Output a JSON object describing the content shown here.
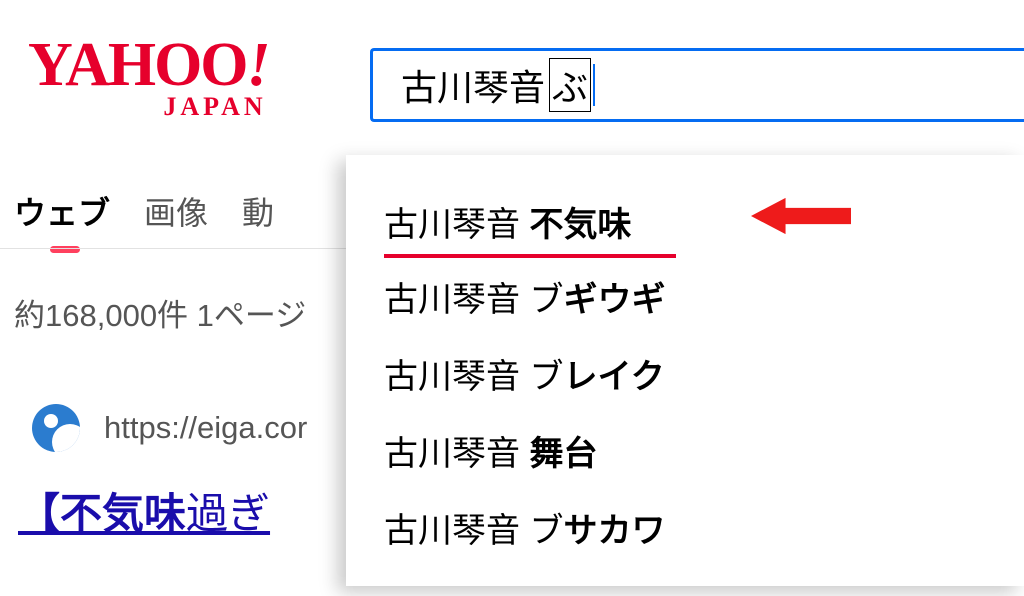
{
  "logo": {
    "main": "YAHOO",
    "sub": "JAPAN"
  },
  "search": {
    "query_fixed": "古川琴音 ",
    "query_ime": "ぶ"
  },
  "tabs": {
    "web": "ウェブ",
    "image": "画像",
    "video_cut": "動"
  },
  "results": {
    "count_text": "約168,000件 1ページ",
    "first": {
      "url": "https://eiga.cor",
      "title_em": "【不気味",
      "title_rest": "過ぎ"
    }
  },
  "suggestions": [
    {
      "prefix": "古川琴音 ",
      "bold": "不気味"
    },
    {
      "prefix": "古川琴音 ブ",
      "bold": "ギウギ"
    },
    {
      "prefix": "古川琴音 ブ",
      "bold": "レイク"
    },
    {
      "prefix": "古川琴音 ",
      "bold": "舞台"
    },
    {
      "prefix": "古川琴音 ブ",
      "bold": "サカワ"
    }
  ],
  "annotation": {
    "arrow_color": "#ee1b1b"
  }
}
